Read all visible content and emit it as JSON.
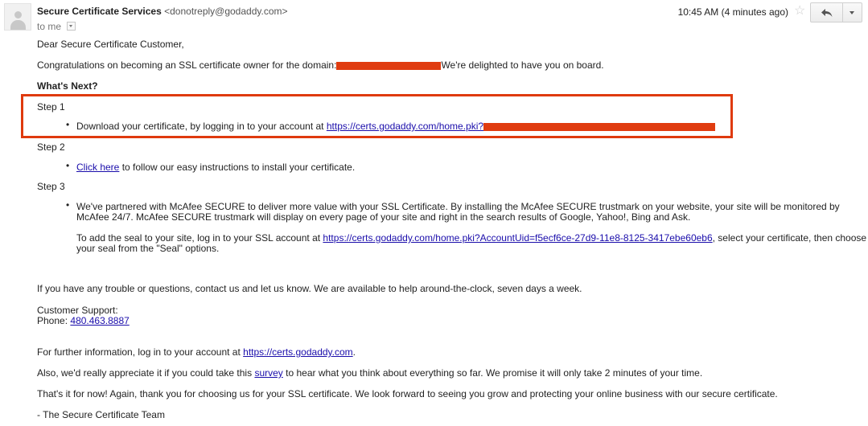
{
  "header": {
    "sender_name": "Secure Certificate Services",
    "sender_email": "<donotreply@godaddy.com>",
    "to_me": "to me",
    "timestamp": "10:45 AM (4 minutes ago)",
    "icons": [
      "avatar-icon",
      "star-icon",
      "reply-icon",
      "more-dropdown-icon",
      "recipient-dropdown-icon"
    ]
  },
  "body": {
    "greeting": "Dear Secure Certificate Customer,",
    "intro_before": "Congratulations on becoming an SSL certificate owner for the domain:",
    "intro_after": "We're delighted to have you on board.",
    "whats_next": "What's Next?",
    "step1_title": "Step 1",
    "step1_text": "Download your certificate, by logging in to your account at",
    "step1_link": "https://certs.godaddy.com/home.pki?",
    "step2_title": "Step 2",
    "step2_link": "Click here",
    "step2_text": "to follow our easy instructions to install your certificate.",
    "step3_title": "Step 3",
    "step3_line1": "We've partnered with McAfee SECURE to deliver more value with your SSL Certificate. By installing the McAfee SECURE trustmark on your website, your site will be monitored by",
    "step3_line2": "McAfee 24/7. McAfee SECURE trustmark will display on every page of your site and right in the search results of Google, Yahoo!, Bing and Ask.",
    "seal_before": "To add the seal to your site, log in to your SSL account at",
    "seal_link": "https://certs.godaddy.com/home.pki?AccountUid=f5ecf6ce-27d9-11e8-8125-3417ebe60eb6",
    "seal_after": ", select your certificate, then choose",
    "seal_line2": "your seal from the \"Seal\" options.",
    "trouble": "If you have any trouble or questions, contact us and let us know. We are available to help around-the-clock, seven days a week.",
    "support_label": "Customer Support:",
    "phone_label": "Phone:",
    "phone": "480.463.8887",
    "further_before": "For further information, log in to your account at",
    "further_link": "https://certs.godaddy.com",
    "further_after": ".",
    "survey_before": "Also, we'd really appreciate it if you could take this",
    "survey_link": "survey",
    "survey_after": "to hear what you think about everything so far. We promise it will only take 2 minutes of your time.",
    "thanks": "That's it for now! Again, thank you for choosing us for your SSL certificate. We look forward to seeing you grow and protecting your online business with our secure certificate.",
    "signoff": "- The Secure Certificate Team"
  },
  "colors": {
    "redaction": "#e03c10",
    "highlight_box": "#df3a0e",
    "link": "#1a0dab"
  }
}
